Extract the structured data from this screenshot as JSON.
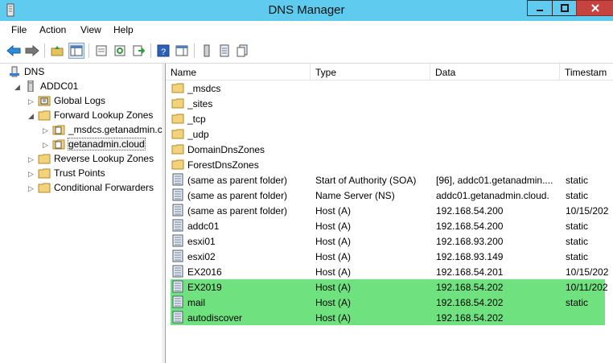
{
  "window": {
    "title": "DNS Manager"
  },
  "menu": [
    "File",
    "Action",
    "View",
    "Help"
  ],
  "tree": {
    "root": "DNS",
    "server": "ADDC01",
    "items": [
      {
        "label": "Global Logs"
      },
      {
        "label": "Forward Lookup Zones"
      },
      {
        "label": "_msdcs.getanadmin.c"
      },
      {
        "label": "getanadmin.cloud"
      },
      {
        "label": "Reverse Lookup Zones"
      },
      {
        "label": "Trust Points"
      },
      {
        "label": "Conditional Forwarders"
      }
    ]
  },
  "list": {
    "columns": [
      "Name",
      "Type",
      "Data",
      "Timestam"
    ],
    "rows": [
      {
        "name": "_msdcs",
        "type": "",
        "data": "",
        "ts": "",
        "icon": "folder-icon"
      },
      {
        "name": "_sites",
        "type": "",
        "data": "",
        "ts": "",
        "icon": "folder-icon"
      },
      {
        "name": "_tcp",
        "type": "",
        "data": "",
        "ts": "",
        "icon": "folder-icon"
      },
      {
        "name": "_udp",
        "type": "",
        "data": "",
        "ts": "",
        "icon": "folder-icon"
      },
      {
        "name": "DomainDnsZones",
        "type": "",
        "data": "",
        "ts": "",
        "icon": "folder-icon"
      },
      {
        "name": "ForestDnsZones",
        "type": "",
        "data": "",
        "ts": "",
        "icon": "folder-icon"
      },
      {
        "name": "(same as parent folder)",
        "type": "Start of Authority (SOA)",
        "data": "[96], addc01.getanadmin....",
        "ts": "static",
        "icon": "record-icon"
      },
      {
        "name": "(same as parent folder)",
        "type": "Name Server (NS)",
        "data": "addc01.getanadmin.cloud.",
        "ts": "static",
        "icon": "record-icon"
      },
      {
        "name": "(same as parent folder)",
        "type": "Host (A)",
        "data": "192.168.54.200",
        "ts": "10/15/202",
        "icon": "record-icon"
      },
      {
        "name": "addc01",
        "type": "Host (A)",
        "data": "192.168.54.200",
        "ts": "static",
        "icon": "record-icon"
      },
      {
        "name": "esxi01",
        "type": "Host (A)",
        "data": "192.168.93.200",
        "ts": "static",
        "icon": "record-icon"
      },
      {
        "name": "esxi02",
        "type": "Host (A)",
        "data": "192.168.93.149",
        "ts": "static",
        "icon": "record-icon"
      },
      {
        "name": "EX2016",
        "type": "Host (A)",
        "data": "192.168.54.201",
        "ts": "10/15/202",
        "icon": "record-icon"
      },
      {
        "name": "EX2019",
        "type": "Host (A)",
        "data": "192.168.54.202",
        "ts": "10/11/202",
        "icon": "record-icon",
        "highlight": true
      },
      {
        "name": "mail",
        "type": "Host (A)",
        "data": "192.168.54.202",
        "ts": "static",
        "icon": "record-icon",
        "highlight": true
      },
      {
        "name": "autodiscover",
        "type": "Host (A)",
        "data": "192.168.54.202",
        "ts": "",
        "icon": "record-icon",
        "highlight": true
      }
    ]
  },
  "colors": {
    "titlebar": "#5fcbef",
    "highlight": "#6fe27f",
    "close": "#c7433f"
  }
}
